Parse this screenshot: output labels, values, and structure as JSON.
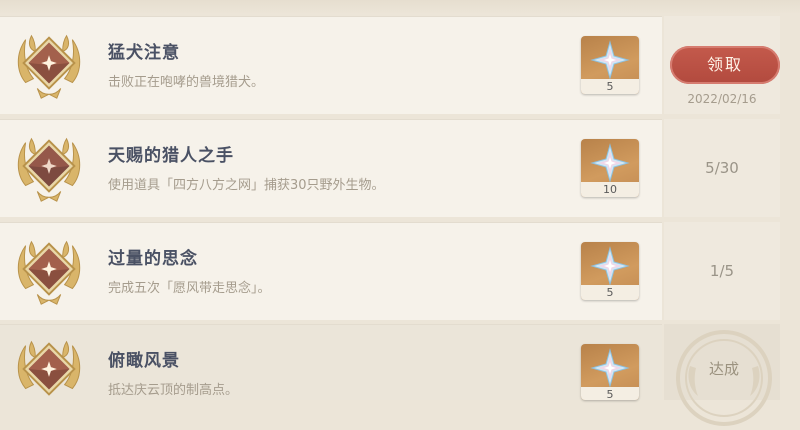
{
  "achievements": [
    {
      "title": "猛犬注意",
      "description": "击败正在咆哮的兽境猎犬。",
      "reward_count": "5",
      "status": "claimable",
      "claim_label": "领取",
      "date": "2022/02/16"
    },
    {
      "title": "天赐的猎人之手",
      "description": "使用道具「四方八方之网」捕获30只野外生物。",
      "reward_count": "10",
      "status": "in-progress",
      "progress": "5/30"
    },
    {
      "title": "过量的思念",
      "description": "完成五次「愿风带走思念」。",
      "reward_count": "5",
      "status": "in-progress",
      "progress": "1/5"
    },
    {
      "title": "俯瞰风景",
      "description": "抵达庆云顶的制高点。",
      "reward_count": "5",
      "status": "completed",
      "completed_label": "达成"
    }
  ],
  "colors": {
    "claim_button": "#b24a3e",
    "reward_tile": "#c28a52",
    "title_text": "#4a5164",
    "description_text": "#a59c8d"
  },
  "icons": {
    "medal": "gold-laurel-medal-icon",
    "reward": "primogem-icon"
  }
}
